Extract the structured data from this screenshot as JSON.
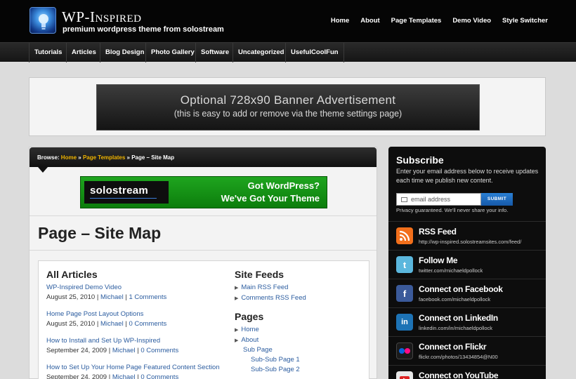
{
  "header": {
    "site_title": "WP-Inspired",
    "tagline": "premium wordpress theme from solostream",
    "nav": [
      "Home",
      "About",
      "Page Templates",
      "Demo Video",
      "Style Switcher"
    ]
  },
  "categories": [
    "Tutorials",
    "Articles",
    "Blog Design",
    "Photo Gallery",
    "Software",
    "Uncategorized",
    "UsefulCoolFun"
  ],
  "banner": {
    "line1": "Optional 728x90 Banner Advertisement",
    "line2": "(this is easy to add or remove via the theme settings page)"
  },
  "breadcrumb": {
    "prefix": "Browse:",
    "home": "Home",
    "sep1": "»",
    "section": "Page Templates",
    "sep2": "»",
    "current": "Page – Site Map"
  },
  "ad": {
    "brand": "solostream",
    "line1": "Got WordPress?",
    "line2": "We've Got Your Theme"
  },
  "page_title": "Page – Site Map",
  "all_articles": {
    "heading": "All Articles",
    "items": [
      {
        "title": "WP-Inspired Demo Video",
        "date": "August 25, 2010",
        "author": "Michael",
        "comments": "1 Comments"
      },
      {
        "title": "Home Page Post Layout Options",
        "date": "August 25, 2010",
        "author": "Michael",
        "comments": "0 Comments"
      },
      {
        "title": "How to Install and Set Up WP-Inspired",
        "date": "September 24, 2009",
        "author": "Michael",
        "comments": "0 Comments"
      },
      {
        "title": "How to Set Up Your Home Page Featured Content Section",
        "date": "September 24, 2009",
        "author": "Michael",
        "comments": "0 Comments"
      }
    ]
  },
  "site_feeds": {
    "heading": "Site Feeds",
    "items": [
      "Main RSS Feed",
      "Comments RSS Feed"
    ]
  },
  "pages": {
    "heading": "Pages",
    "items": [
      "Home",
      "About",
      "Sub Page",
      "Sub-Sub Page 1",
      "Sub-Sub Page 2"
    ]
  },
  "subscribe": {
    "heading": "Subscribe",
    "text": "Enter your email address below to receive updates each time we publish new content.",
    "placeholder": "email address",
    "button": "SUBMIT",
    "privacy": "Privacy guaranteed. We'll never share your info."
  },
  "social": [
    {
      "title": "RSS Feed",
      "url": "http://wp-inspired.solostreamsites.com/feed/",
      "icon": "rss-icon",
      "color": "#f26f1b"
    },
    {
      "title": "Follow Me",
      "url": "twitter.com/michaeldpollock",
      "icon": "twitter-icon",
      "color": "#5bb7dd"
    },
    {
      "title": "Connect on Facebook",
      "url": "facebook.com/michaeldpollock",
      "icon": "facebook-icon",
      "color": "#3b5a9a"
    },
    {
      "title": "Connect on LinkedIn",
      "url": "linkedin.com/in/michaeldpollock",
      "icon": "linkedin-icon",
      "color": "#1d73b5"
    },
    {
      "title": "Connect on Flickr",
      "url": "flickr.com/photos/13434854@N00",
      "icon": "flickr-icon",
      "color": "#1a1a1a"
    },
    {
      "title": "Connect on YouTube",
      "url": "",
      "icon": "youtube-icon",
      "color": "#e8e8e8"
    }
  ]
}
